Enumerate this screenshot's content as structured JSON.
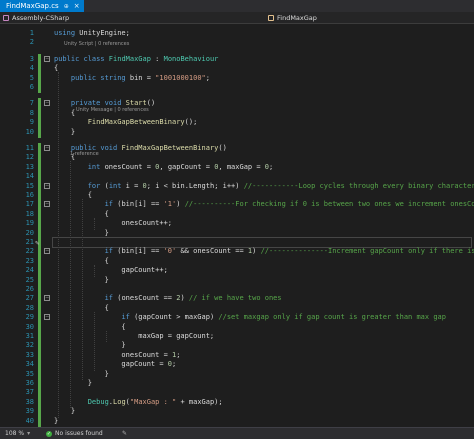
{
  "tab": {
    "title": "FindMaxGap.cs",
    "close_glyph": "×",
    "pin_glyph": "⊕"
  },
  "navigation": {
    "project": "Assembly-CSharp",
    "member": "FindMaxGap"
  },
  "code_lens": {
    "class": "Unity Script | 0 references",
    "start": "Unity Message | 0 references",
    "method": "1 reference"
  },
  "lines": [
    {
      "n": "1",
      "tokens": [
        [
          "k",
          "using"
        ],
        [
          "d",
          " UnityEngine;"
        ]
      ]
    },
    {
      "n": "2",
      "tokens": []
    },
    {
      "n": "3",
      "tokens": [
        [
          "k",
          "public class"
        ],
        [
          "d",
          " "
        ],
        [
          "t",
          "FindMaxGap"
        ],
        [
          "d",
          " : "
        ],
        [
          "t",
          "MonoBehaviour"
        ]
      ]
    },
    {
      "n": "4",
      "tokens": [
        [
          "d",
          "{"
        ]
      ]
    },
    {
      "n": "5",
      "tokens": [
        [
          "d",
          "    "
        ],
        [
          "k",
          "public string"
        ],
        [
          "d",
          " bin = "
        ],
        [
          "s",
          "\"1001000100\""
        ],
        [
          "d",
          ";"
        ]
      ]
    },
    {
      "n": "6",
      "tokens": []
    },
    {
      "n": "7",
      "tokens": [
        [
          "d",
          "    "
        ],
        [
          "k",
          "private void"
        ],
        [
          "d",
          " "
        ],
        [
          "m",
          "Start"
        ],
        [
          "d",
          "()"
        ]
      ]
    },
    {
      "n": "8",
      "tokens": [
        [
          "d",
          "    {"
        ]
      ]
    },
    {
      "n": "9",
      "tokens": [
        [
          "d",
          "        "
        ],
        [
          "m",
          "FindMaxGapBetweenBinary"
        ],
        [
          "d",
          "();"
        ]
      ]
    },
    {
      "n": "10",
      "tokens": [
        [
          "d",
          "    }"
        ]
      ]
    },
    {
      "n": "11",
      "tokens": [
        [
          "d",
          "    "
        ],
        [
          "k",
          "public void"
        ],
        [
          "d",
          " "
        ],
        [
          "m",
          "FindMaxGapBetweenBinary"
        ],
        [
          "d",
          "()"
        ]
      ]
    },
    {
      "n": "12",
      "tokens": [
        [
          "d",
          "    {"
        ]
      ]
    },
    {
      "n": "13",
      "tokens": [
        [
          "d",
          "        "
        ],
        [
          "k",
          "int"
        ],
        [
          "d",
          " onesCount = "
        ],
        [
          "n",
          "0"
        ],
        [
          "d",
          ", gapCount = "
        ],
        [
          "n",
          "0"
        ],
        [
          "d",
          ", maxGap = "
        ],
        [
          "n",
          "0"
        ],
        [
          "d",
          ";"
        ]
      ]
    },
    {
      "n": "14",
      "tokens": []
    },
    {
      "n": "15",
      "tokens": [
        [
          "d",
          "        "
        ],
        [
          "k",
          "for"
        ],
        [
          "d",
          " ("
        ],
        [
          "k",
          "int"
        ],
        [
          "d",
          " i = "
        ],
        [
          "n",
          "0"
        ],
        [
          "d",
          "; i < bin.Length; i++) "
        ],
        [
          "c",
          "//-----------Loop cycles through every binary character"
        ]
      ]
    },
    {
      "n": "16",
      "tokens": [
        [
          "d",
          "        {"
        ]
      ]
    },
    {
      "n": "17",
      "tokens": [
        [
          "d",
          "            "
        ],
        [
          "k",
          "if"
        ],
        [
          "d",
          " (bin[i] == "
        ],
        [
          "s",
          "'1'"
        ],
        [
          "d",
          ") "
        ],
        [
          "c",
          "//----------For checking if 0 is between two ones we increment onesCount"
        ]
      ]
    },
    {
      "n": "18",
      "tokens": [
        [
          "d",
          "            {"
        ]
      ]
    },
    {
      "n": "19",
      "tokens": [
        [
          "d",
          "                onesCount++;"
        ]
      ]
    },
    {
      "n": "20",
      "tokens": [
        [
          "d",
          "            }"
        ]
      ]
    },
    {
      "n": "21",
      "tokens": []
    },
    {
      "n": "22",
      "tokens": [
        [
          "d",
          "            "
        ],
        [
          "k",
          "if"
        ],
        [
          "d",
          " (bin[i] == "
        ],
        [
          "s",
          "'0'"
        ],
        [
          "d",
          " && onesCount == "
        ],
        [
          "n",
          "1"
        ],
        [
          "d",
          ") "
        ],
        [
          "c",
          "//--------------Increment gapCount only if there is a 1 before"
        ]
      ]
    },
    {
      "n": "23",
      "tokens": [
        [
          "d",
          "            {"
        ]
      ]
    },
    {
      "n": "24",
      "tokens": [
        [
          "d",
          "                gapCount++;"
        ]
      ]
    },
    {
      "n": "25",
      "tokens": [
        [
          "d",
          "            }"
        ]
      ]
    },
    {
      "n": "26",
      "tokens": []
    },
    {
      "n": "27",
      "tokens": [
        [
          "d",
          "            "
        ],
        [
          "k",
          "if"
        ],
        [
          "d",
          " (onesCount == "
        ],
        [
          "n",
          "2"
        ],
        [
          "d",
          ") "
        ],
        [
          "c",
          "// if we have two ones"
        ]
      ]
    },
    {
      "n": "28",
      "tokens": [
        [
          "d",
          "            {"
        ]
      ]
    },
    {
      "n": "29",
      "tokens": [
        [
          "d",
          "                "
        ],
        [
          "k",
          "if"
        ],
        [
          "d",
          " (gapCount > maxGap) "
        ],
        [
          "c",
          "//set maxgap only if gap count is greater than max gap"
        ]
      ]
    },
    {
      "n": "30",
      "tokens": [
        [
          "d",
          "                {"
        ]
      ]
    },
    {
      "n": "31",
      "tokens": [
        [
          "d",
          "                    maxGap = gapCount;"
        ]
      ]
    },
    {
      "n": "32",
      "tokens": [
        [
          "d",
          "                }"
        ]
      ]
    },
    {
      "n": "33",
      "tokens": [
        [
          "d",
          "                onesCount = "
        ],
        [
          "n",
          "1"
        ],
        [
          "d",
          ";"
        ]
      ]
    },
    {
      "n": "34",
      "tokens": [
        [
          "d",
          "                gapCount = "
        ],
        [
          "n",
          "0"
        ],
        [
          "d",
          ";"
        ]
      ]
    },
    {
      "n": "35",
      "tokens": [
        [
          "d",
          "            }"
        ]
      ]
    },
    {
      "n": "36",
      "tokens": [
        [
          "d",
          "        }"
        ]
      ]
    },
    {
      "n": "37",
      "tokens": []
    },
    {
      "n": "38",
      "tokens": [
        [
          "d",
          "        "
        ],
        [
          "t",
          "Debug"
        ],
        [
          "d",
          "."
        ],
        [
          "m",
          "Log"
        ],
        [
          "d",
          "("
        ],
        [
          "s",
          "\"MaxGap : \""
        ],
        [
          "d",
          " + maxGap);"
        ]
      ]
    },
    {
      "n": "39",
      "tokens": [
        [
          "d",
          "    }"
        ]
      ]
    },
    {
      "n": "40",
      "tokens": [
        [
          "d",
          "}"
        ]
      ]
    },
    {
      "n": "41",
      "tokens": []
    }
  ],
  "status_bar": {
    "zoom": "108 %",
    "issues": "No issues found"
  },
  "colors": {
    "background": "#1e1e1e",
    "line_number": "#2b91af",
    "keyword": "#569cd6",
    "type": "#4ec9b0",
    "method": "#dcdcaa",
    "string": "#d69d85",
    "comment": "#57a64a",
    "change_bar": "#57a64a",
    "tab_active": "#007acc"
  }
}
